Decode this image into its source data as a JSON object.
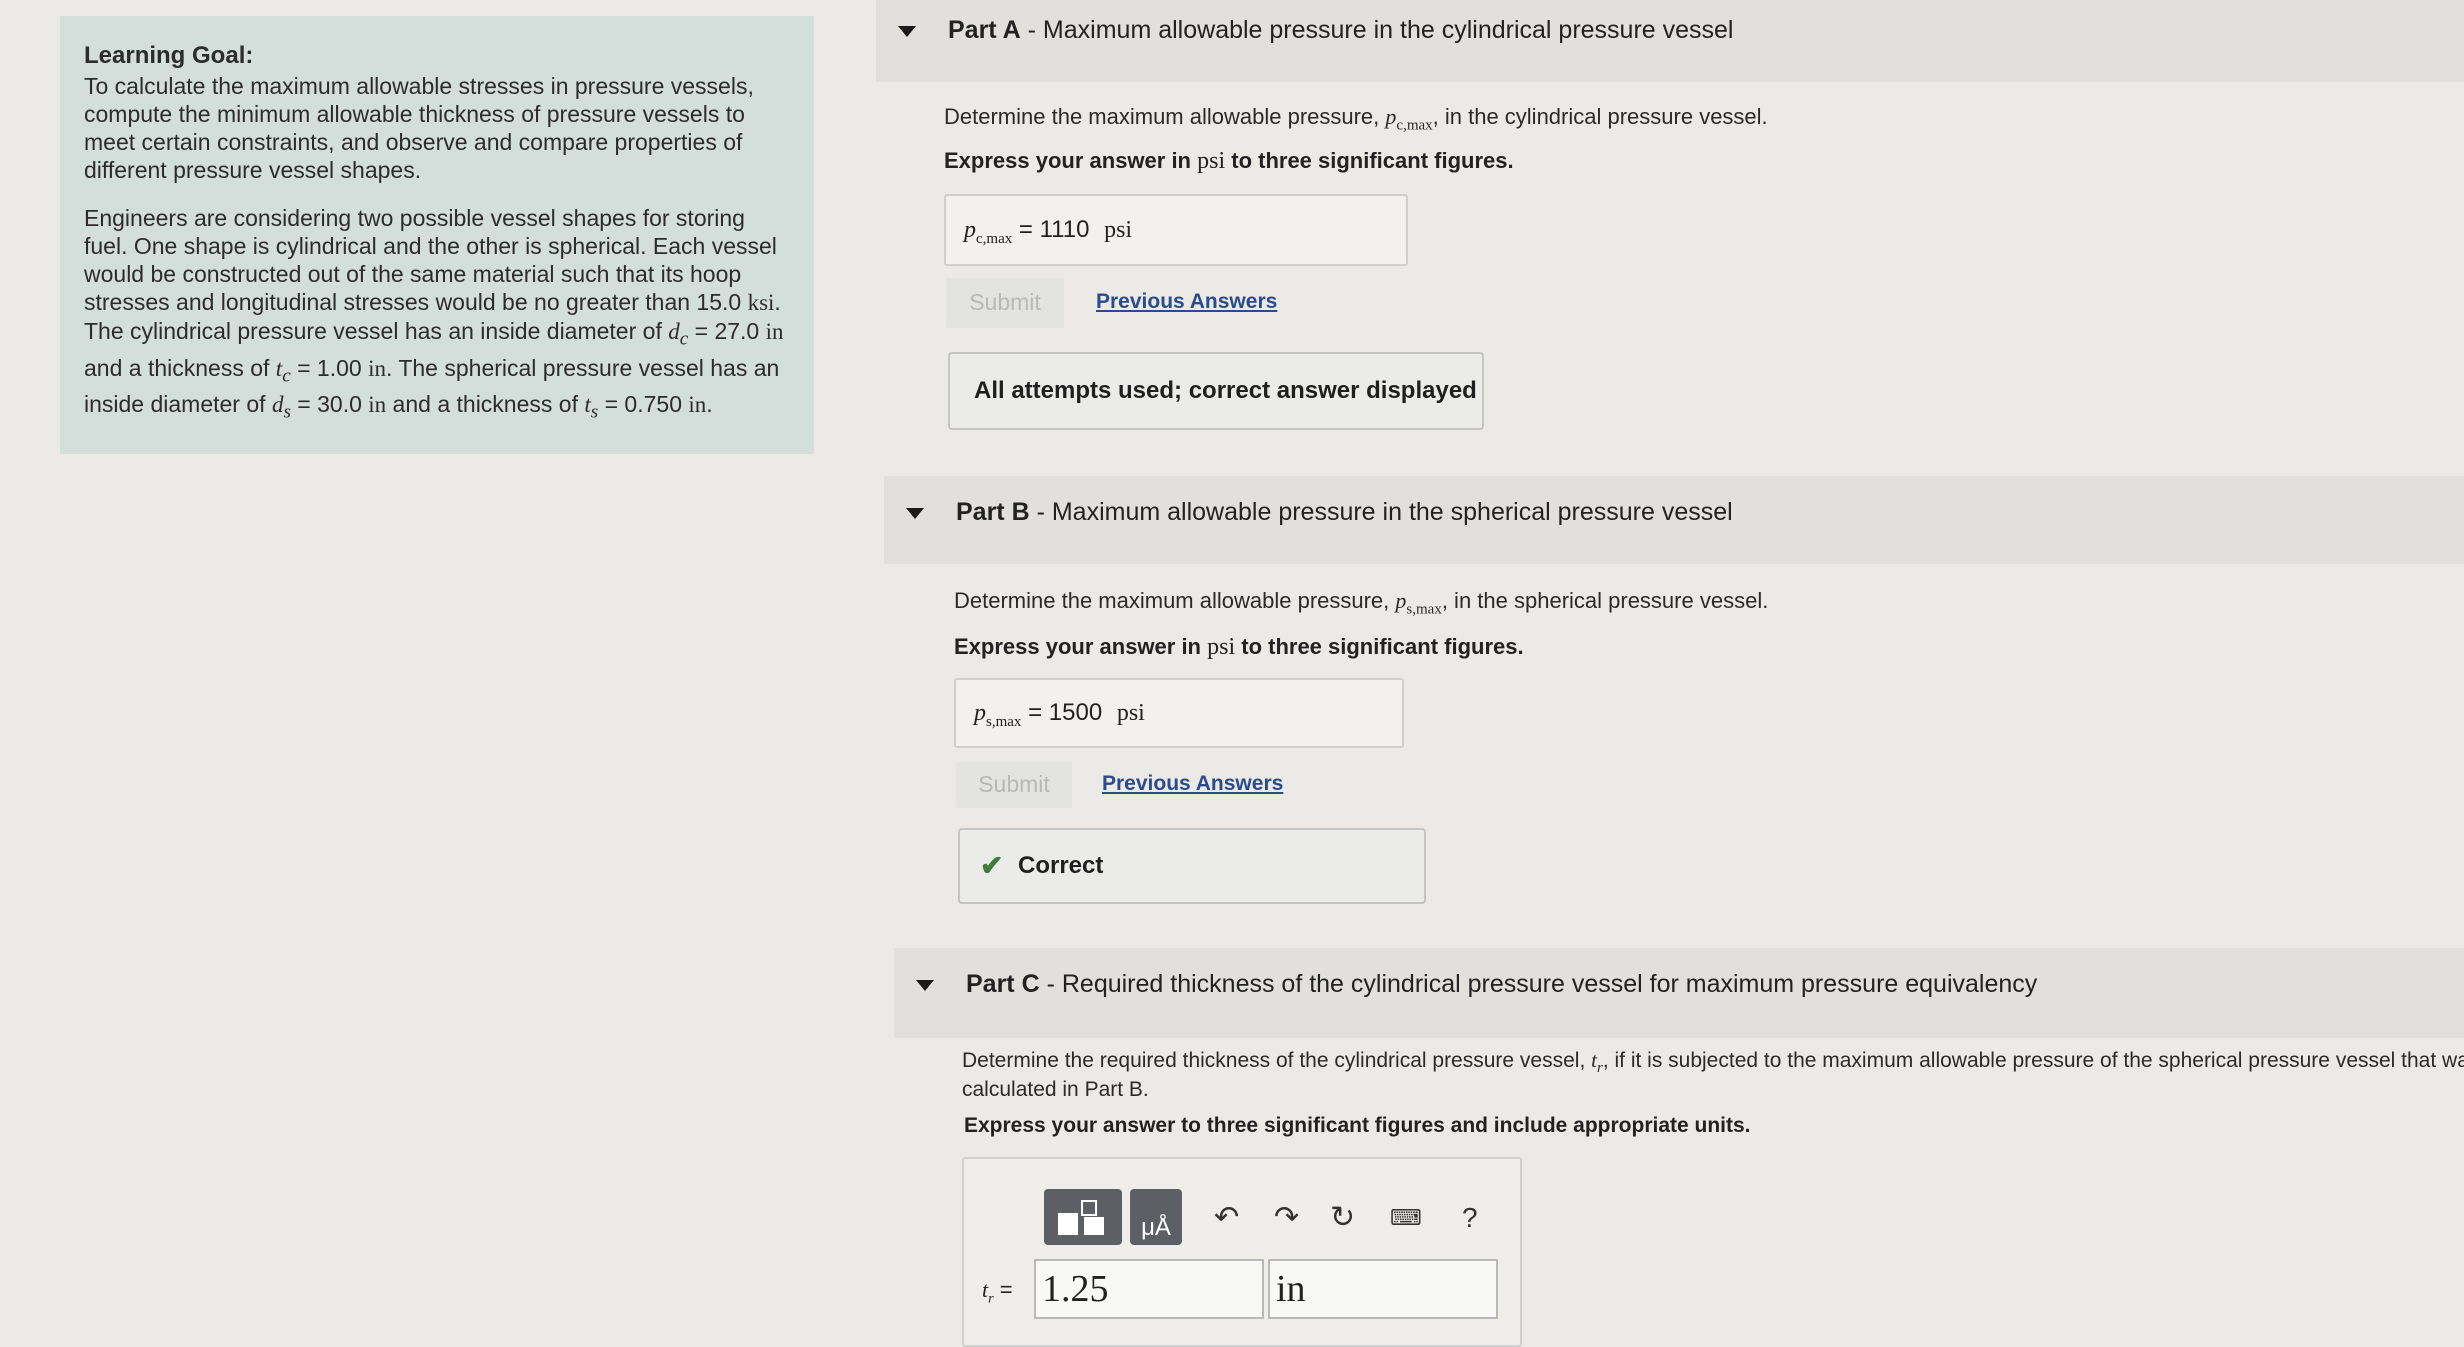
{
  "goal": {
    "title": "Learning Goal:",
    "text": "To calculate the maximum allowable stresses in pressure vessels, compute the minimum allowable thickness of pressure vessels to meet certain constraints, and observe and compare properties of different pressure vessel shapes.",
    "p2_a": "Engineers are considering two possible vessel shapes for storing fuel. One shape is cylindrical and the other is spherical. Each vessel would be constructed out of the same material such that its hoop stresses and longitudinal stresses would be no greater than 15.0 ",
    "p2_ksi": "ksi",
    "p2_b": ". The cylindrical pressure vessel has an inside diameter of ",
    "dc_sym": "d",
    "dc_sub": "c",
    "dc_val": " = 27.0 ",
    "in1": "in",
    "p2_c": " and a thickness of ",
    "tc_sym": "t",
    "tc_sub": "c",
    "tc_val": " = 1.00 ",
    "in2": "in",
    "p2_d": ". The spherical pressure vessel has an inside diameter of ",
    "ds_sym": "d",
    "ds_sub": "s",
    "ds_val": " = 30.0 ",
    "in3": "in",
    "p2_e": " and a thickness of ",
    "ts_sym": "t",
    "ts_sub": "s",
    "ts_val": " = 0.750 ",
    "in4": "in",
    "p2_f": "."
  },
  "partA": {
    "label": "Part A",
    "title": " - Maximum allowable pressure in the cylindrical pressure vessel",
    "q1": "Determine the maximum allowable pressure, ",
    "var_p": "p",
    "var_sub": "c,max",
    "q2": ", in the cylindrical pressure vessel.",
    "instr1": "Express your answer in ",
    "instr_unit": "psi",
    "instr2": " to three significant figures.",
    "answer_value": "1110",
    "answer_unit": "psi",
    "submit": "Submit",
    "prev": "Previous Answers",
    "feedback": "All attempts used; correct answer displayed"
  },
  "partB": {
    "label": "Part B",
    "title": " - Maximum allowable pressure in the spherical pressure vessel",
    "q1": "Determine the maximum allowable pressure, ",
    "var_p": "p",
    "var_sub": "s,max",
    "q2": ", in the spherical pressure vessel.",
    "instr1": "Express your answer in ",
    "instr_unit": "psi",
    "instr2": " to three significant figures.",
    "answer_value": "1500",
    "answer_unit": "psi",
    "submit": "Submit",
    "prev": "Previous Answers",
    "feedback": "Correct"
  },
  "partC": {
    "label": "Part C",
    "title": " - Required thickness of the cylindrical pressure vessel for maximum pressure equivalency",
    "q1": "Determine the required thickness of the cylindrical pressure vessel, ",
    "var_t": "t",
    "var_sub": "r",
    "q2": ", if it is subjected to the maximum allowable pressure of the spherical pressure vessel that was",
    "q3": "calculated in Part B.",
    "instr": "Express your answer to three significant figures and include appropriate units.",
    "input_label_sym": "t",
    "input_label_sub": "r",
    "input_value": "1.25",
    "unit_value": "in",
    "help": "?"
  }
}
